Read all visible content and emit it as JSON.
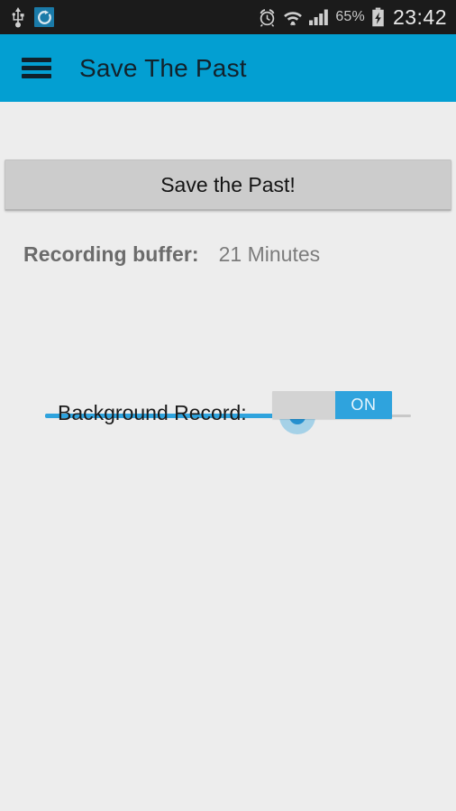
{
  "status_bar": {
    "icons_left": [
      {
        "name": "usb-icon",
        "label": "USB connected"
      },
      {
        "name": "sync-icon",
        "label": "Sync active"
      }
    ],
    "icons_right": [
      {
        "name": "alarm-clock-icon",
        "label": "Alarm set"
      },
      {
        "name": "wifi-icon",
        "label": "Wi-Fi connected"
      },
      {
        "name": "signal-bars-icon",
        "label": "Mobile signal"
      }
    ],
    "battery_percent": "65%",
    "battery_icon": "battery-charging-icon",
    "clock": "23:42",
    "background_color": "#1b1b1b"
  },
  "app_bar": {
    "menu_icon": "hamburger-menu-icon",
    "title": "Save The Past",
    "background_color": "#039fd2",
    "title_color": "#12222c"
  },
  "main": {
    "background_color": "#ededed",
    "save_button": {
      "label": "Save the Past!",
      "background_color": "#cccccc"
    },
    "recording_buffer": {
      "label": "Recording buffer:",
      "value": "21 Minutes",
      "slider": {
        "percent": 69,
        "fill_color": "#2fa3dd",
        "track_color": "#c8c8c8",
        "thumb_color": "#2590cf"
      }
    },
    "background_record": {
      "label": "Background Record:",
      "state": "ON",
      "on_color": "#2fa3dd",
      "off_color": "#d3d3d3"
    }
  }
}
